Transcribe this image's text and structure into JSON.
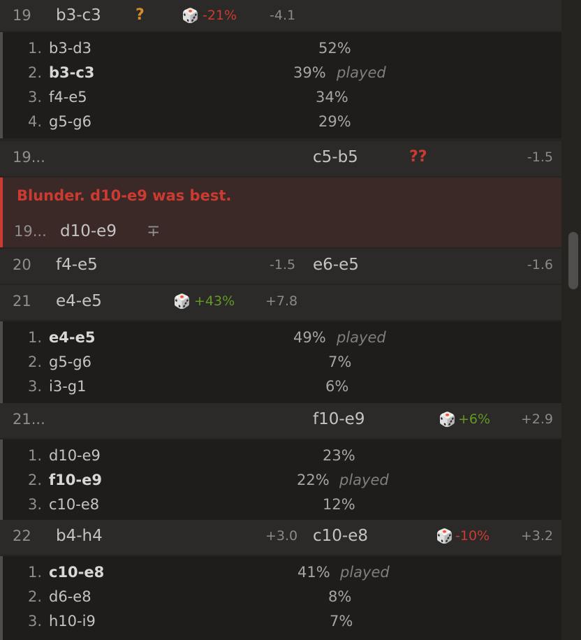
{
  "moves": [
    {
      "type": "white-row",
      "num": "19",
      "white": "b3-c3",
      "glyph": "?",
      "dice": "🎲",
      "pct": "-21%",
      "pct_sign": "neg",
      "eval": "-4.1"
    },
    {
      "type": "alts",
      "items": [
        {
          "idx": "1.",
          "move": "b3-d3",
          "pct": "52%",
          "played": ""
        },
        {
          "idx": "2.",
          "move": "b3-c3",
          "pct": "39%",
          "played": "played"
        },
        {
          "idx": "3.",
          "move": "f4-e5",
          "pct": "34%",
          "played": ""
        },
        {
          "idx": "4.",
          "move": "g5-g6",
          "pct": "29%",
          "played": ""
        }
      ]
    },
    {
      "type": "black-row",
      "num": "19...",
      "black": "c5-b5",
      "glyph": "??",
      "eval": "-1.5"
    },
    {
      "type": "blunder",
      "message": "Blunder. d10-e9 was best.",
      "num": "19...",
      "move": "d10-e9",
      "eval": "∓"
    },
    {
      "type": "full-row",
      "num": "20",
      "white": "f4-e5",
      "white_eval": "-1.5",
      "black": "e6-e5",
      "black_eval": "-1.6"
    },
    {
      "type": "white-row",
      "num": "21",
      "white": "e4-e5",
      "dice": "🎲",
      "pct": "+43%",
      "pct_sign": "pos",
      "eval": "+7.8"
    },
    {
      "type": "alts",
      "items": [
        {
          "idx": "1.",
          "move": "e4-e5",
          "pct": "49%",
          "played": "played"
        },
        {
          "idx": "2.",
          "move": "g5-g6",
          "pct": "7%",
          "played": ""
        },
        {
          "idx": "3.",
          "move": "i3-g1",
          "pct": "6%",
          "played": ""
        }
      ]
    },
    {
      "type": "black-row",
      "num": "21...",
      "black": "f10-e9",
      "dice": "🎲",
      "pct": "+6%",
      "pct_sign": "pos",
      "eval": "+2.9"
    },
    {
      "type": "alts",
      "items": [
        {
          "idx": "1.",
          "move": "d10-e9",
          "pct": "23%",
          "played": ""
        },
        {
          "idx": "2.",
          "move": "f10-e9",
          "pct": "22%",
          "played": "played"
        },
        {
          "idx": "3.",
          "move": "c10-e8",
          "pct": "12%",
          "played": ""
        }
      ]
    },
    {
      "type": "full-row",
      "num": "22",
      "white": "b4-h4",
      "white_eval": "+3.0",
      "black": "c10-e8",
      "dice": "🎲",
      "pct": "-10%",
      "pct_sign": "neg",
      "black_eval": "+3.2"
    },
    {
      "type": "alts",
      "items": [
        {
          "idx": "1.",
          "move": "c10-e8",
          "pct": "41%",
          "played": "played"
        },
        {
          "idx": "2.",
          "move": "d6-e8",
          "pct": "8%",
          "played": ""
        },
        {
          "idx": "3.",
          "move": "h10-i9",
          "pct": "7%",
          "played": ""
        }
      ]
    }
  ],
  "colors": {
    "blunder": "#cc3b32",
    "mistake": "#d48b28",
    "positive": "#629924",
    "background": "#262421"
  }
}
